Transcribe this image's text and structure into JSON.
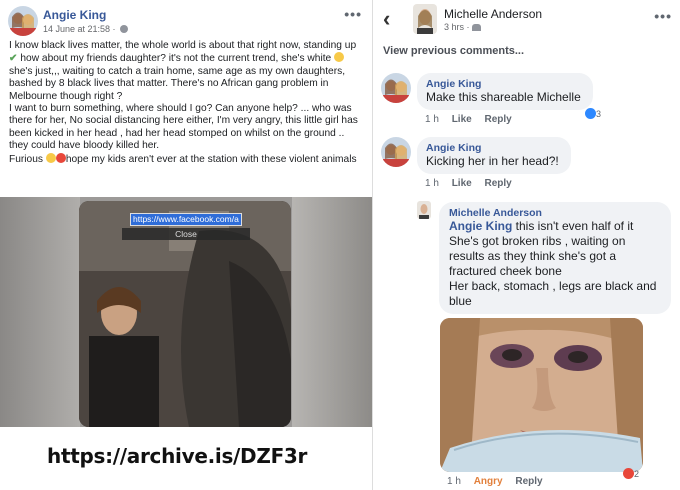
{
  "left_post": {
    "author": "Angie King",
    "timestamp": "14 June at 21:58 · ",
    "more_label": "•••",
    "paragraphs": [
      "I know black lives matter, the whole world is about that right now, standing up",
      "how about my friends daughter? it's not the current trend, she's white",
      "she's just,,, waiting to catch a train home, same age as my own daughters, bashed by 8 black lives that matter. There's no African gang problem in Melbourne though right ?",
      "I want to burn something, where should I go? Can anyone help? ... who was there for her, No social distancing here either, I'm very angry, this little girl has been kicked in her head , had her head stomped on whilst on the ground .. they could have bloody killed her.",
      "Furious",
      "hope my kids aren't ever at the station with these violent animals"
    ],
    "video": {
      "url_text": "https://www.facebook.com/a",
      "close_label": "Close"
    }
  },
  "archive_link": "https://archive.is/DZF3r",
  "right_panel": {
    "back_icon": "‹",
    "author": "Michelle Anderson",
    "meta": "3 hrs · ",
    "more_label": "•••",
    "view_previous": "View previous comments...",
    "comments": [
      {
        "name": "Angie King",
        "text": "Make this shareable Michelle",
        "time": "1 h",
        "like": "Like",
        "reply": "Reply",
        "reaction_count": "3"
      },
      {
        "name": "Angie King",
        "text": "Kicking her in her head?!",
        "time": "1 h",
        "like": "Like",
        "reply": "Reply"
      },
      {
        "name": "Michelle Anderson",
        "mention": "Angie King",
        "text": " this isn't even half of it She's got broken ribs , waiting on results as they think she's got a fractured cheek bone",
        "text2": "Her back, stomach , legs are black and blue",
        "time": "1 h",
        "reaction_word": "Angry",
        "reply": "Reply",
        "reaction_count": "2"
      }
    ]
  },
  "colors": {
    "link_blue": "#385898",
    "bubble_bg": "#f0f2f5",
    "angry_orange": "#e2803c",
    "url_highlight": "#2f6dd8"
  }
}
